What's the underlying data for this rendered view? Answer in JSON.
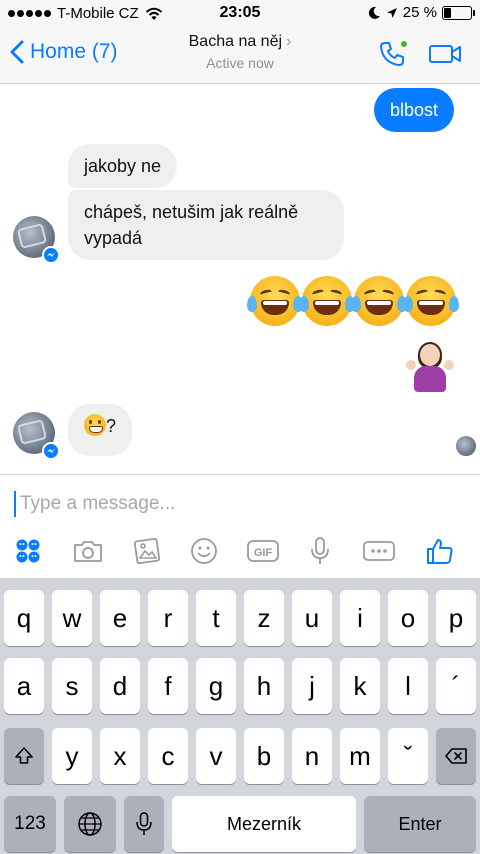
{
  "status_bar": {
    "carrier": "T-Mobile CZ",
    "time": "23:05",
    "battery_percent": "25 %",
    "battery_level": 0.25
  },
  "header": {
    "back_label": "Home (7)",
    "contact_name": "Bacha na něj",
    "presence": "Active now",
    "accent_color": "#0a7cff"
  },
  "messages": [
    {
      "direction": "outgoing",
      "text": "blbost"
    },
    {
      "direction": "incoming",
      "text": "jakoby ne"
    },
    {
      "direction": "incoming",
      "text": "chápeš, netušim jak reálně vypadá"
    },
    {
      "direction": "outgoing",
      "emoji": "face-with-tears-of-joy x4"
    },
    {
      "direction": "outgoing",
      "emoji": "person-shrugging"
    },
    {
      "direction": "incoming",
      "emoji_prefix": "grinning-face",
      "text": "?"
    }
  ],
  "composer": {
    "placeholder": "Type a message...",
    "tools": [
      "apps-icon",
      "camera-icon",
      "gallery-icon",
      "emoji-icon",
      "gif-icon",
      "microphone-icon",
      "more-icon",
      "like-icon"
    ]
  },
  "keyboard": {
    "row1": [
      "q",
      "w",
      "e",
      "r",
      "t",
      "z",
      "u",
      "i",
      "o",
      "p"
    ],
    "row2": [
      "a",
      "s",
      "d",
      "f",
      "g",
      "h",
      "j",
      "k",
      "l",
      "´"
    ],
    "row3": [
      "y",
      "x",
      "c",
      "v",
      "b",
      "n",
      "m",
      "ˇ"
    ],
    "numbers_label": "123",
    "space_label": "Mezerník",
    "enter_label": "Enter"
  }
}
